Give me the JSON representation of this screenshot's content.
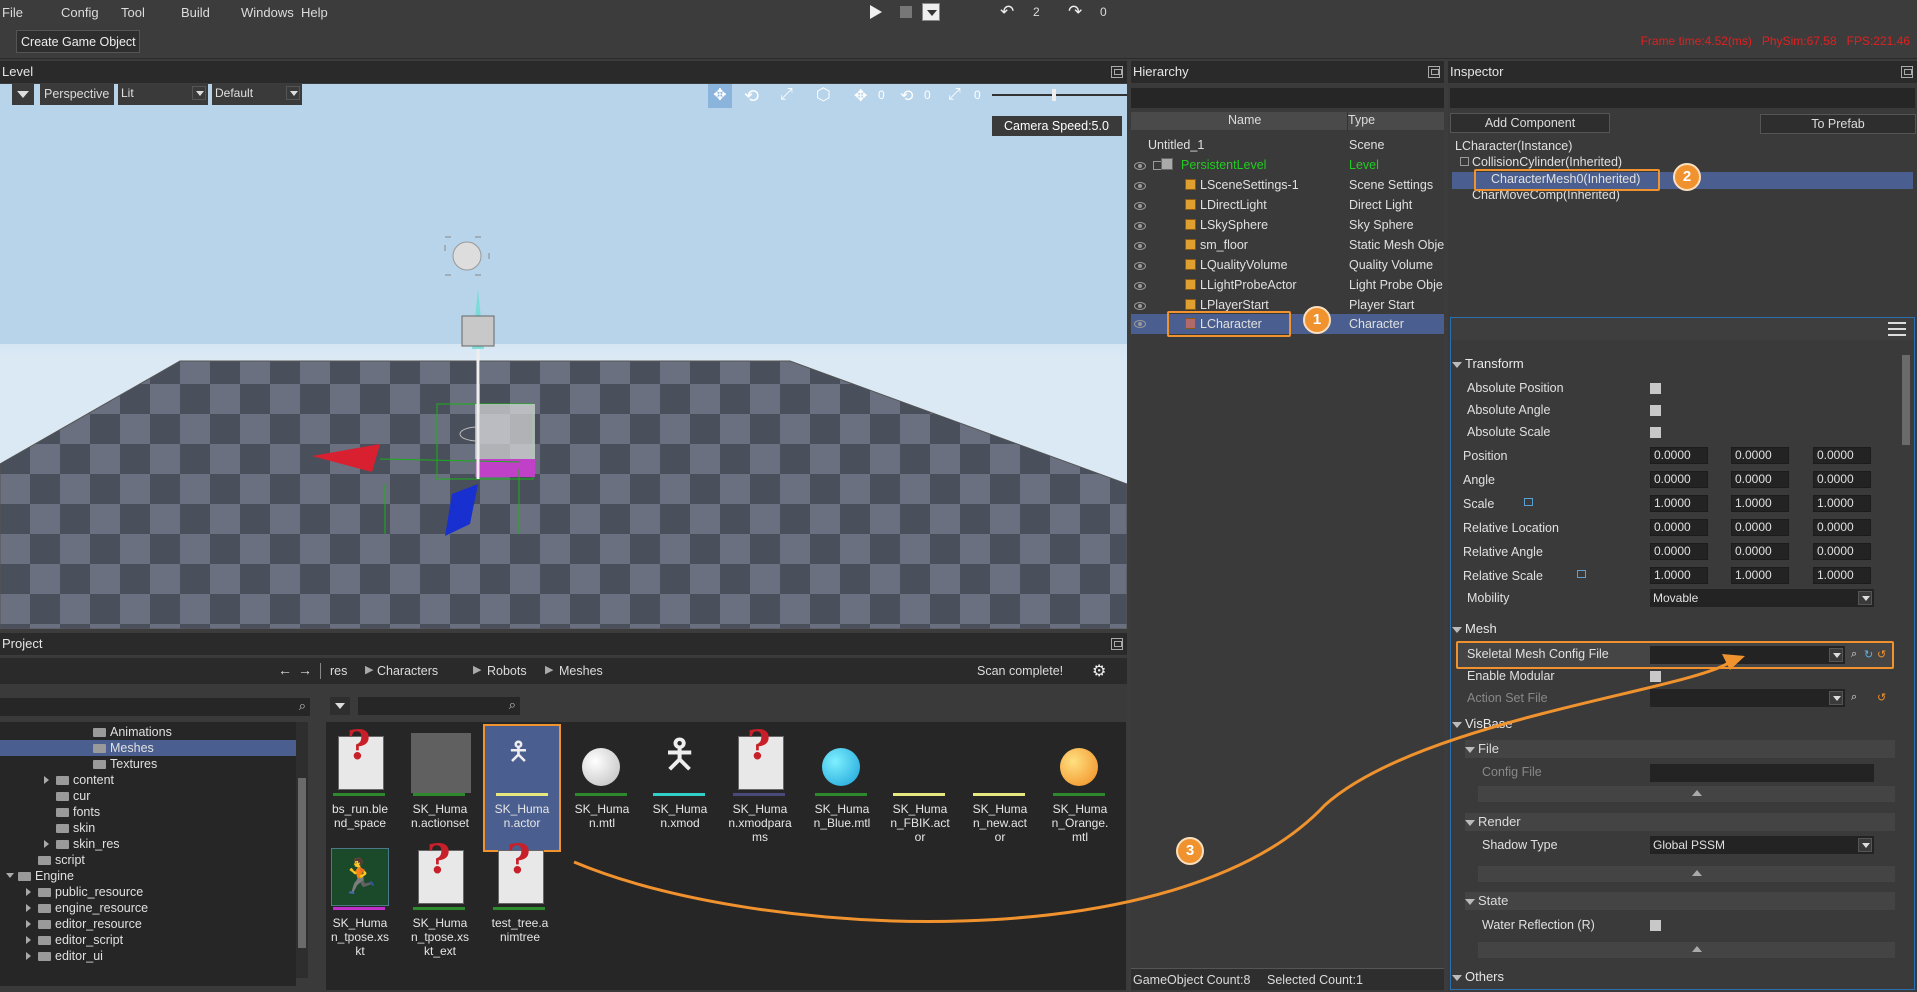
{
  "menu": [
    "File",
    "Config",
    "Tool",
    "Build",
    "Windows",
    "Help"
  ],
  "toolbar": {
    "create_btn": "Create Game Object",
    "undo_count": "2",
    "redo_count": "0",
    "status": "Frame time:4.52(ms)   PhySim:67.58   FPS:221.46"
  },
  "level": {
    "title": "Level",
    "view_mode": "Perspective",
    "shading": "Lit",
    "preset": "Default",
    "gizmo_counts": [
      "0",
      "0",
      "0"
    ],
    "camera_speed": "Camera Speed:5.0"
  },
  "hierarchy": {
    "title": "Hierarchy",
    "col_name": "Name",
    "col_type": "Type",
    "rows": [
      {
        "name": "Untitled_1",
        "type": "Scene"
      },
      {
        "name": "PersistentLevel",
        "type": "Level"
      },
      {
        "name": "LSceneSettings-1",
        "type": "Scene Settings"
      },
      {
        "name": "LDirectLight",
        "type": "Direct Light"
      },
      {
        "name": "LSkySphere",
        "type": "Sky Sphere"
      },
      {
        "name": "sm_floor",
        "type": "Static Mesh Obje"
      },
      {
        "name": "LQualityVolume",
        "type": "Quality Volume"
      },
      {
        "name": "LLightProbeActor",
        "type": "Light Probe Obje"
      },
      {
        "name": "LPlayerStart",
        "type": "Player Start"
      },
      {
        "name": "LCharacter",
        "type": "Character"
      }
    ],
    "footer_count": "GameObject Count:8",
    "footer_selected": "Selected Count:1"
  },
  "inspector": {
    "title": "Inspector",
    "add_component": "Add Component",
    "to_prefab": "To Prefab",
    "components": [
      "LCharacter(Instance)",
      "CollisionCylinder(Inherited)",
      "CharacterMesh0(Inherited)",
      "CharMoveComp(Inherited)"
    ],
    "transform": {
      "header": "Transform",
      "abs_position": "Absolute Position",
      "abs_angle": "Absolute Angle",
      "abs_scale": "Absolute Scale",
      "position": {
        "label": "Position",
        "values": [
          "0.0000",
          "0.0000",
          "0.0000"
        ]
      },
      "angle": {
        "label": "Angle",
        "values": [
          "0.0000",
          "0.0000",
          "0.0000"
        ]
      },
      "scale": {
        "label": "Scale",
        "values": [
          "1.0000",
          "1.0000",
          "1.0000"
        ]
      },
      "rel_location": {
        "label": "Relative Location",
        "values": [
          "0.0000",
          "0.0000",
          "0.0000"
        ]
      },
      "rel_angle": {
        "label": "Relative Angle",
        "values": [
          "0.0000",
          "0.0000",
          "0.0000"
        ]
      },
      "rel_scale": {
        "label": "Relative Scale",
        "values": [
          "1.0000",
          "1.0000",
          "1.0000"
        ]
      },
      "mobility_label": "Mobility",
      "mobility_value": "Movable"
    },
    "mesh": {
      "header": "Mesh",
      "skeletal": "Skeletal Mesh Config File",
      "modular": "Enable Modular",
      "action_set": "Action Set File"
    },
    "visbase": {
      "header": "VisBase",
      "file": "File",
      "config": "Config File",
      "render": "Render",
      "shadow_label": "Shadow Type",
      "shadow_value": "Global PSSM",
      "state": "State",
      "water": "Water Reflection (R)",
      "others": "Others"
    }
  },
  "project": {
    "title": "Project",
    "breadcrumb": [
      "res",
      "Characters",
      "Robots",
      "Meshes"
    ],
    "scan_status": "Scan complete!",
    "tree": [
      {
        "label": "Animations",
        "depth": 6
      },
      {
        "label": "Meshes",
        "depth": 6
      },
      {
        "label": "Textures",
        "depth": 6
      },
      {
        "label": "content",
        "depth": 3
      },
      {
        "label": "cur",
        "depth": 3
      },
      {
        "label": "fonts",
        "depth": 3
      },
      {
        "label": "skin",
        "depth": 3
      },
      {
        "label": "skin_res",
        "depth": 3
      },
      {
        "label": "script",
        "depth": 2
      },
      {
        "label": "Engine",
        "depth": 0
      },
      {
        "label": "public_resource",
        "depth": 1
      },
      {
        "label": "engine_resource",
        "depth": 1
      },
      {
        "label": "editor_resource",
        "depth": 1
      },
      {
        "label": "editor_script",
        "depth": 1
      },
      {
        "label": "editor_ui",
        "depth": 1
      }
    ],
    "assets": [
      "bs_run.blend_space",
      "SK_Human.actionset",
      "SK_Human.actor",
      "SK_Human.mtl",
      "SK_Human.xmod",
      "SK_Human.xmodparams",
      "SK_Human_Blue.mtl",
      "SK_Human_FBIK.actor",
      "SK_Human_new.actor",
      "SK_Human_Orange.mtl",
      "SK_Human_tpose.xskt",
      "SK_Human_tpose.xskt_ext",
      "test_tree.animtree"
    ]
  },
  "annotations": [
    "1",
    "2",
    "3"
  ],
  "colors": {
    "accent": "#f0922e",
    "selection": "#4a5f8f",
    "level_green": "#22cc22",
    "status_red": "#e02020"
  }
}
